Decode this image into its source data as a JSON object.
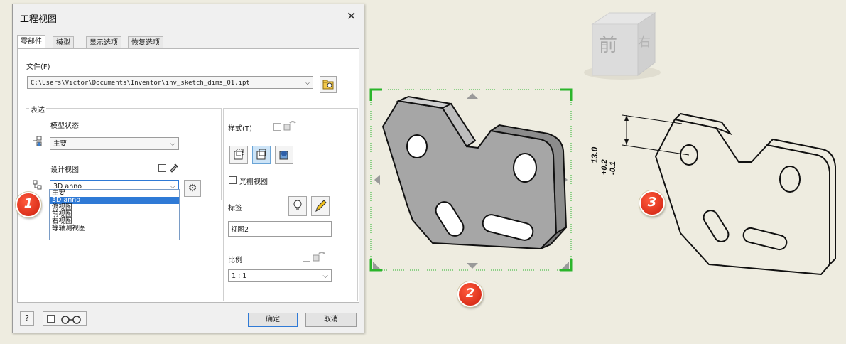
{
  "dialog": {
    "title": "工程视图",
    "tabs": [
      "零部件",
      "模型",
      "显示选项",
      "恢复选项"
    ],
    "file_label": "文件(F)",
    "file_path": "C:\\Users\\Victor\\Documents\\Inventor\\inv_sketch_dims_01.ipt",
    "representation_label": "表达",
    "model_state_label": "模型状态",
    "model_state_value": "主要",
    "design_view_label": "设计视图",
    "design_view_value": "3D anno",
    "design_view_options": [
      "主要",
      "3D anno",
      "俯视图",
      "前视图",
      "右视图",
      "等轴测视图"
    ],
    "design_view_selected_index": 1,
    "style_label": "样式(T)",
    "raster_view_label": "光栅视图",
    "label_label": "标签",
    "label_value": "视图2",
    "scale_label": "比例",
    "scale_value": "1 : 1",
    "ok_label": "确定",
    "cancel_label": "取消"
  },
  "viewcube": {
    "front_label": "前",
    "right_label": "右"
  },
  "dimension_text": "13.0",
  "tolerance_upper": "+0.2",
  "tolerance_lower": "-0.1",
  "badges": [
    "1",
    "2",
    "3"
  ],
  "colors": {
    "selection_green": "#2bb52b",
    "badge_red": "#e2321a",
    "canvas_bg": "#eeece0",
    "part_gray": "#a6a6a6"
  }
}
